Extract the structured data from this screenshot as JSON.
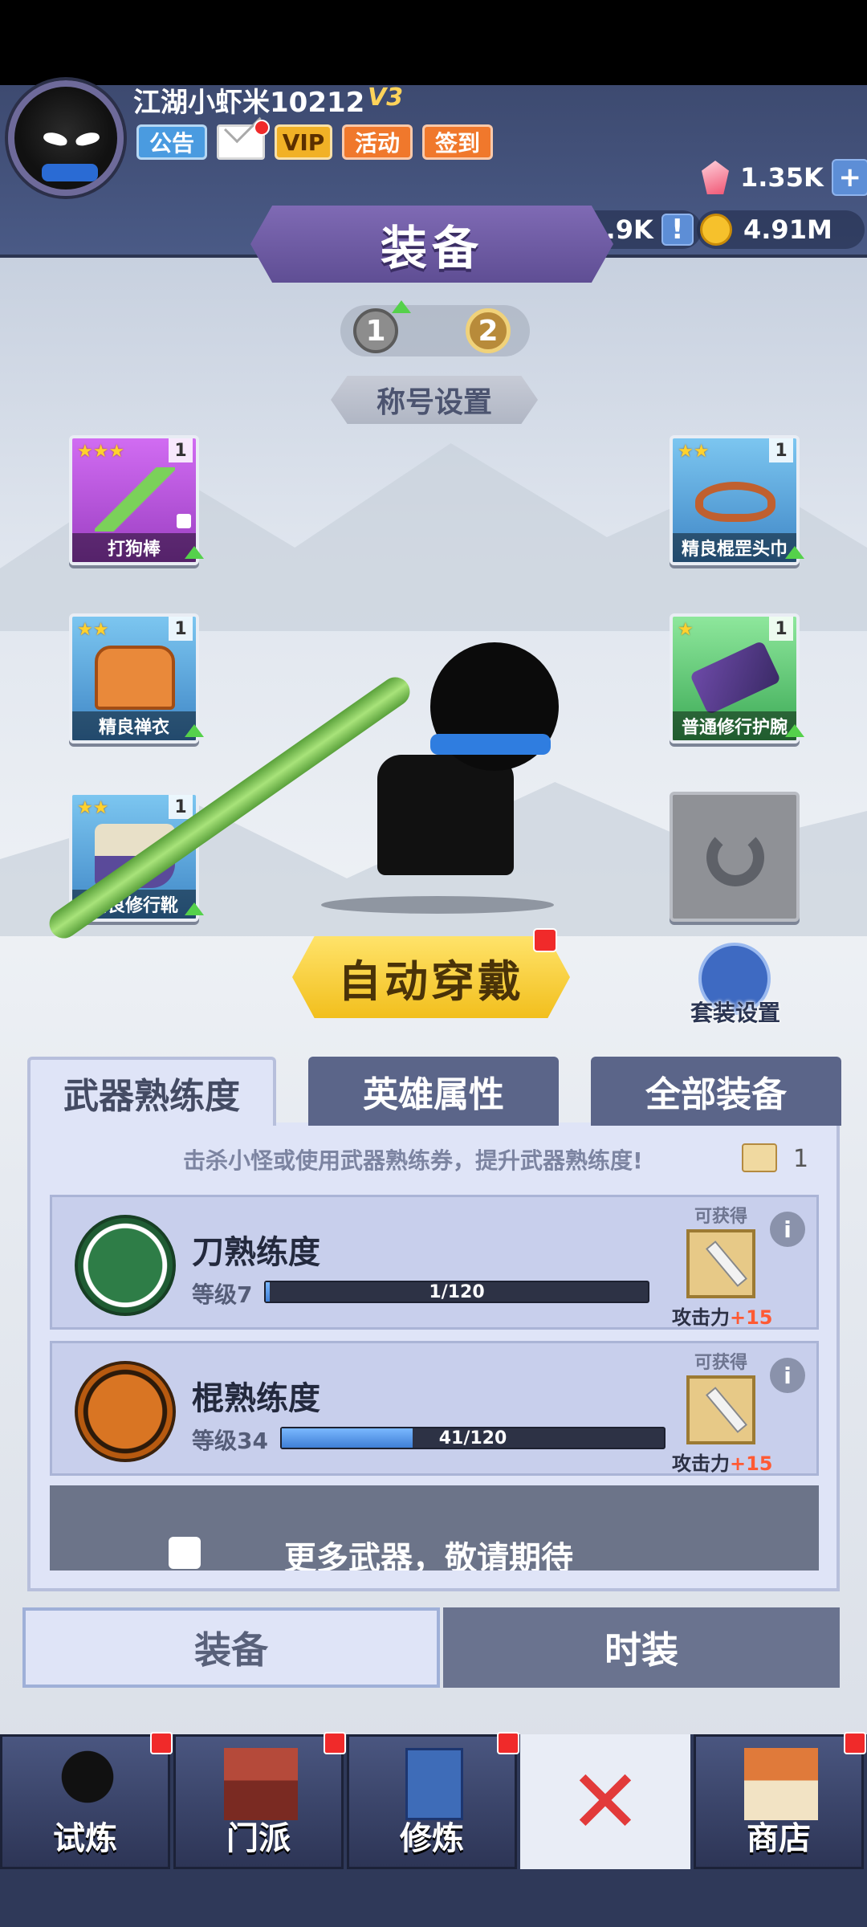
{
  "header": {
    "player_name": "江湖小虾米10212",
    "vip_level": "V3",
    "buttons": [
      "公告",
      "VIP",
      "活动",
      "签到"
    ],
    "gems": "1.35K",
    "honor": "21.9K",
    "gold": "4.91M",
    "plus": "+",
    "excl": "!"
  },
  "equip": {
    "title": "装备",
    "pages": [
      "1",
      "2"
    ],
    "title_setting": "称号设置",
    "slots": [
      {
        "name": "打狗棒",
        "level": "1",
        "stars": "★★★"
      },
      {
        "name": "精良棍罡头巾",
        "level": "1",
        "stars": "★★"
      },
      {
        "name": "精良禅衣",
        "level": "1",
        "stars": "★★"
      },
      {
        "name": "普通修行护腕",
        "level": "1",
        "stars": "★"
      },
      {
        "name": "精良修行靴",
        "level": "1",
        "stars": "★★"
      }
    ],
    "auto_wear": "自动穿戴",
    "suit_setting": "套装设置"
  },
  "panel": {
    "tabs": [
      "武器熟练度",
      "英雄属性",
      "全部装备"
    ],
    "hint": "击杀小怪或使用武器熟练券，提升武器熟练度!",
    "scroll_count": "1",
    "weapons": [
      {
        "name": "刀熟练度",
        "level": "等级7",
        "progress_text": "1/120",
        "progress": 0.0083,
        "obtain": "可获得",
        "attack": "攻击力",
        "bonus": "+15"
      },
      {
        "name": "棍熟练度",
        "level": "等级34",
        "progress_text": "41/120",
        "progress": 0.3417,
        "obtain": "可获得",
        "attack": "攻击力",
        "bonus": "+15"
      }
    ],
    "more": "更多武器，敬请期待",
    "info": "i"
  },
  "bottom_tabs": [
    "装备",
    "时装"
  ],
  "nav": [
    "试炼",
    "门派",
    "修炼",
    "商店"
  ],
  "nav_close": "✕",
  "colors": {
    "accent": "#5b6589",
    "gold_button": "#f2bf1d",
    "progress": "#3f7fd6",
    "bonus": "#ff5a34"
  }
}
